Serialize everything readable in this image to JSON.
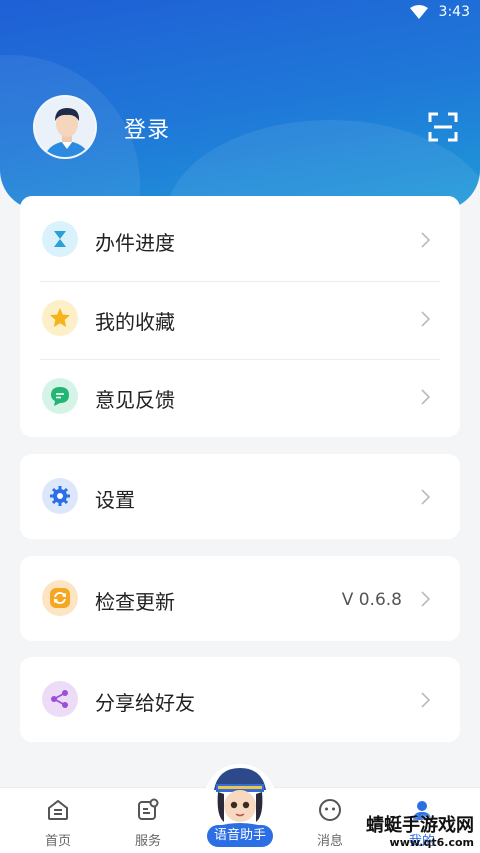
{
  "status_bar": {
    "time": "3:43"
  },
  "profile": {
    "login_label": "登录"
  },
  "menu_group_1": [
    {
      "label": "办件进度",
      "icon": "hourglass-icon"
    },
    {
      "label": "我的收藏",
      "icon": "star-icon"
    },
    {
      "label": "意见反馈",
      "icon": "chat-icon"
    }
  ],
  "settings": {
    "label": "设置",
    "icon": "gear-icon"
  },
  "update": {
    "label": "检查更新",
    "icon": "refresh-icon",
    "version": "V 0.6.8"
  },
  "share": {
    "label": "分享给好友",
    "icon": "share-icon"
  },
  "tabbar": {
    "home": "首页",
    "service": "服务",
    "voice": "语音助手",
    "messages": "消息",
    "mine": "我的"
  },
  "watermark": {
    "title": "蜻蜓手游戏网",
    "url": "www.qt6.com"
  },
  "colors": {
    "header_blue": "#1f6fd8",
    "accent": "#2b6ee6"
  }
}
